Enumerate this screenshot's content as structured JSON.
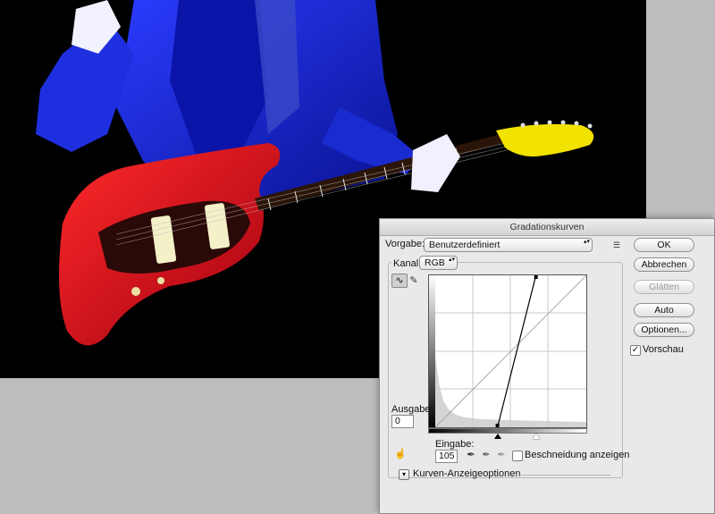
{
  "dialog": {
    "title": "Gradationskurven",
    "preset": {
      "label": "Vorgabe:",
      "value": "Benutzerdefiniert"
    },
    "channel": {
      "label": "Kanal:",
      "value": "RGB"
    },
    "output": {
      "label": "Ausgabe:",
      "value": "0"
    },
    "input": {
      "label": "Eingabe:",
      "value": "105"
    },
    "clipping_label": "Beschneidung anzeigen",
    "clipping_checked": false,
    "curve_options_label": "Kurven-Anzeigeoptionen",
    "buttons": {
      "ok": "OK",
      "cancel": "Abbrechen",
      "smooth": "Glätten",
      "auto": "Auto",
      "options": "Optionen..."
    },
    "preview": {
      "label": "Vorschau",
      "checked": true,
      "checkmark": "✓"
    },
    "curve": {
      "black_input": 105,
      "white_input": 170,
      "scale_max": 255
    },
    "icons": {
      "preset_menu": "☰",
      "curve_tool": "∿",
      "pencil_tool": "✎",
      "hand_tool": "☝",
      "eyedropper_black": "✒",
      "eyedropper_gray": "✒",
      "eyedropper_white": "✒",
      "disclosure": "▾",
      "select_arrows": "▴▾"
    }
  }
}
